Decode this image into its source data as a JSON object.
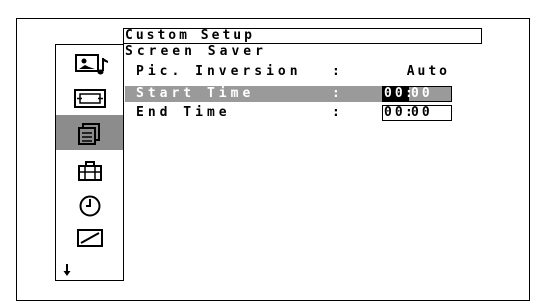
{
  "header": {
    "title": "Custom Setup"
  },
  "submenu": {
    "title": "Screen Saver"
  },
  "settings": {
    "pic_inversion": {
      "label": "Pic. Inversion",
      "colon": ":",
      "value": "Auto"
    },
    "start_time": {
      "label": "Start Time",
      "colon": ":",
      "hour": "00",
      "sep": ":",
      "minute": "00"
    },
    "end_time": {
      "label": "End Time",
      "colon": ":",
      "hour": "00",
      "sep": ":",
      "minute": "00"
    }
  },
  "sidebar": {
    "icons": [
      "picture-sound-icon",
      "screen-size-icon",
      "custom-setup-icon",
      "toolbox-icon",
      "clock-icon",
      "adjust-icon"
    ],
    "selected_index": 2,
    "more_indicator": "down-arrow-icon"
  },
  "colors": {
    "highlight": "#9a9a9a",
    "cursor": "#000000",
    "icon_selected_bg": "#8c8c8c"
  }
}
